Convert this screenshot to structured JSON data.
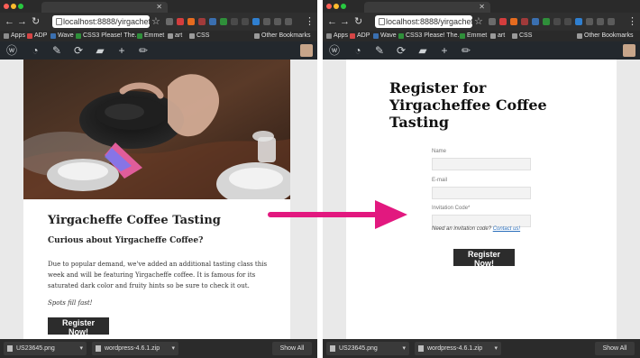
{
  "left": {
    "address": "localhost:8888/yirgacheffe...",
    "bookmarks": [
      "Apps",
      "ADP",
      "Wave",
      "CSS3 Please! The...",
      "Emmet",
      "art",
      "CSS",
      "Other Bookmarks"
    ],
    "post": {
      "title": "Yirgacheffe Coffee Tasting",
      "subtitle": "Curious about Yirgacheffe Coffee?",
      "paragraph": "Due to popular demand, we've added an additional tasting class this week and will be featuring Yirgacheffe coffee. It is famous for its saturated dark color and fruity hints so be sure to check it out.",
      "italic": "Spots fill fast!",
      "button": "Register Now!"
    },
    "downloads": [
      "US23645.png",
      "wordpress-4.6.1.zip"
    ],
    "show_all": "Show All"
  },
  "right": {
    "address": "localhost:8888/yirgacheffe...",
    "bookmarks": [
      "Apps",
      "ADP",
      "Wave",
      "CSS3 Please! The...",
      "Emmet",
      "art",
      "CSS",
      "Other Bookmarks"
    ],
    "form": {
      "title": "Register for Yirgacheffee Coffee Tasting",
      "name_label": "Name",
      "email_label": "E-mail",
      "code_label": "Invitation Code*",
      "hint_prefix": "Need an invitation code?",
      "hint_link": "Contact us!",
      "button": "Register Now!"
    },
    "downloads": [
      "US23645.png",
      "wordpress-4.6.1.zip"
    ],
    "show_all": "Show All"
  },
  "colors": {
    "arrow": "#e2187f",
    "wp_bar": "#23282d",
    "button": "#2c2c2c",
    "link": "#2a6ebb"
  }
}
